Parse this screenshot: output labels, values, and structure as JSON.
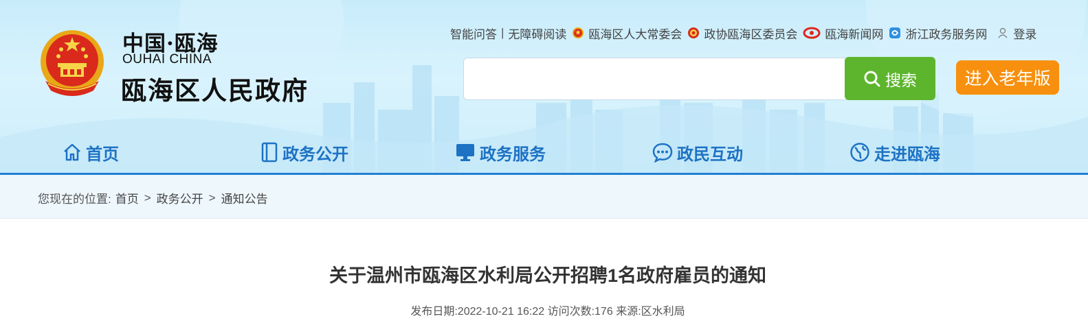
{
  "brand": {
    "cn_small": "中国·瓯海",
    "en": "OUHAI CHINA",
    "title": "瓯海区人民政府"
  },
  "toplinks": {
    "qa": "智能问答",
    "separator": "|",
    "accessible": "无障碍阅读",
    "npc": "瓯海区人大常委会",
    "cppcc": "政协瓯海区委员会",
    "news": "瓯海新闻网",
    "zjzw": "浙江政务服务网",
    "login": "登录"
  },
  "search": {
    "placeholder": "",
    "value": "",
    "button_label": "搜索"
  },
  "elder_mode": {
    "label": "进入老年版"
  },
  "nav": {
    "items": [
      {
        "label": "首页",
        "icon": "home-icon"
      },
      {
        "label": "政务公开",
        "icon": "document-icon"
      },
      {
        "label": "政务服务",
        "icon": "monitor-icon"
      },
      {
        "label": "政民互动",
        "icon": "chat-icon"
      },
      {
        "label": "走进瓯海",
        "icon": "globe-icon"
      }
    ]
  },
  "breadcrumb": {
    "prefix": "您现在的位置:",
    "items": [
      "首页",
      "政务公开",
      "通知公告"
    ],
    "separator": ">"
  },
  "article": {
    "title": "关于温州市瓯海区水利局公开招聘1名政府雇员的通知",
    "publish_label": "发布日期:",
    "publish_date": "2022-10-21 16:22",
    "visits_label": "访问次数:",
    "visits": "176",
    "source_label": "来源:",
    "source": "区水利局"
  },
  "colors": {
    "nav_blue": "#1d72c4",
    "search_green": "#5db52d",
    "elder_orange": "#f7900e",
    "header_rule": "#1f7fd1"
  }
}
